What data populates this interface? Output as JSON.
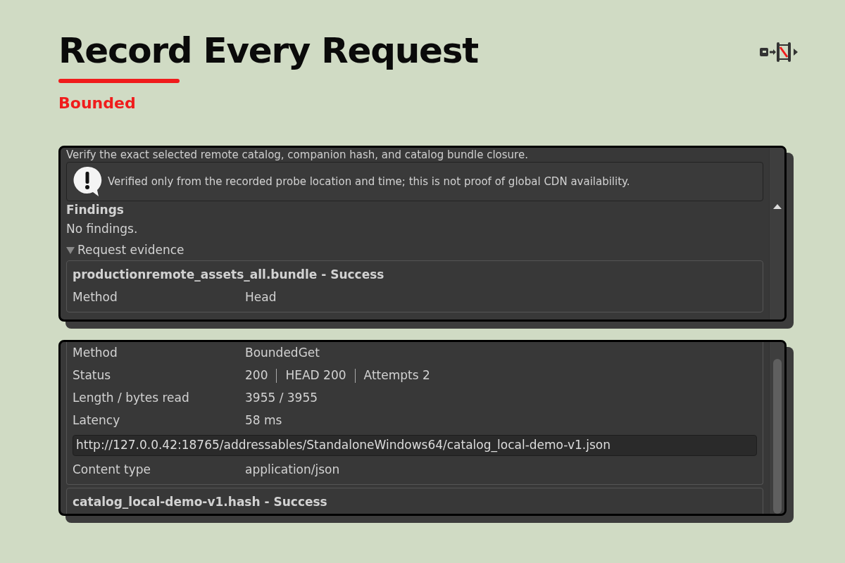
{
  "header": {
    "title": "Record Every Request",
    "subtitle": "Bounded"
  },
  "panels": [
    {
      "intro": "Verify the exact selected remote catalog, companion hash, and catalog bundle closure.",
      "warning": "Verified only from the recorded probe location and time; this is not proof of global CDN availability.",
      "findings_title": "Findings",
      "findings_text": "No findings.",
      "evidence": {
        "label": "Request evidence",
        "expanded": true
      },
      "cards": [
        {
          "title": "productionremote_assets_all.bundle - Success",
          "rows": [
            {
              "kind": "pair",
              "label": "Method",
              "value": "Head"
            }
          ]
        }
      ]
    },
    {
      "cards": [
        {
          "rows": [
            {
              "kind": "pair",
              "label": "Method",
              "value": "BoundedGet"
            },
            {
              "kind": "status",
              "label": "Status",
              "parts": [
                "200",
                "HEAD 200",
                "Attempts 2"
              ]
            },
            {
              "kind": "pair",
              "label": "Length / bytes read",
              "value": "3955 / 3955"
            },
            {
              "kind": "pair",
              "label": "Latency",
              "value": "58 ms"
            },
            {
              "kind": "url",
              "value": "http://127.0.0.42:18765/addressables/StandaloneWindows64/catalog_local-demo-v1.json"
            },
            {
              "kind": "pair",
              "label": "Content type",
              "value": "application/json"
            }
          ]
        },
        {
          "title": "catalog_local-demo-v1.hash - Success"
        }
      ]
    }
  ]
}
